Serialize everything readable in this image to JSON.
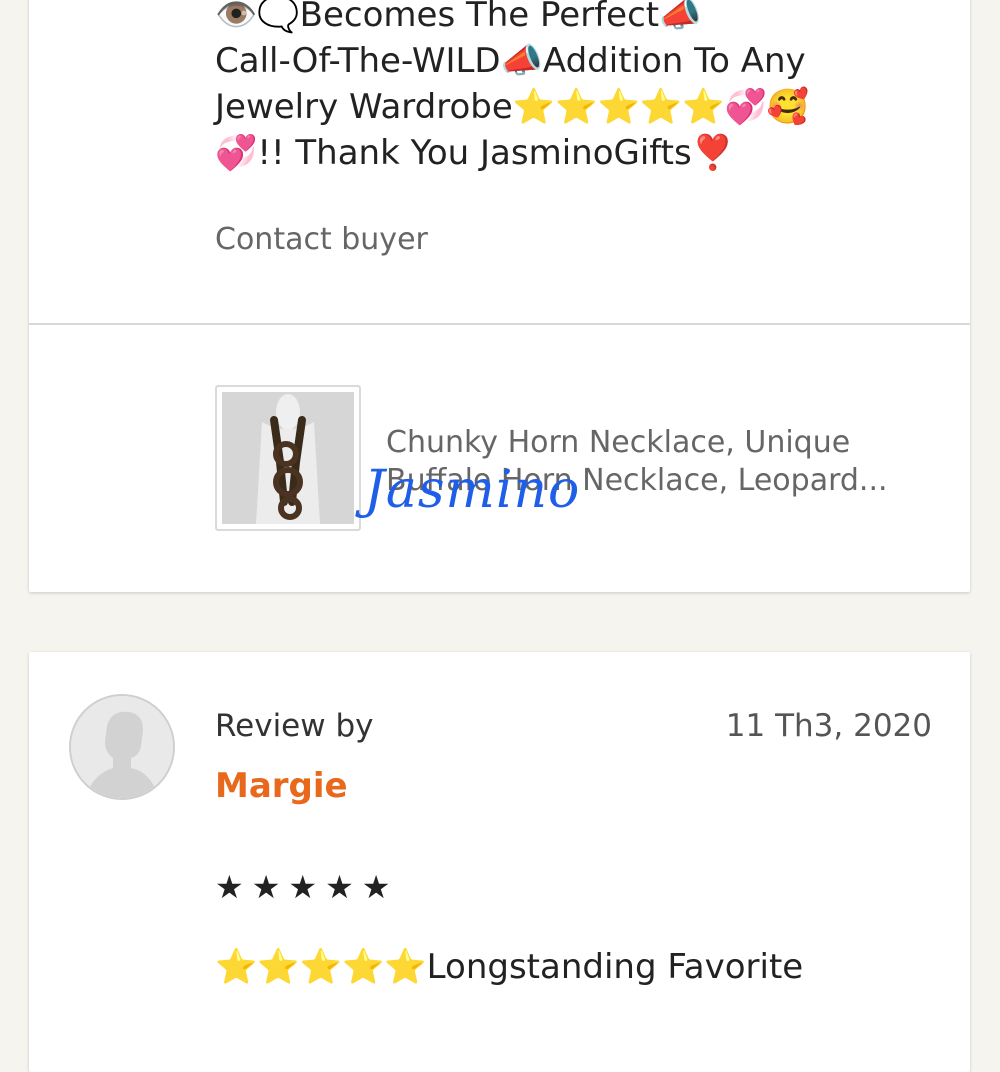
{
  "review1": {
    "text_lines": [
      "👁️🗨️Becomes The Perfect📣",
      "Call-Of-The-WILD📣Addition To Any",
      "Jewelry Wardrobe⭐⭐⭐⭐⭐💞🥰",
      "💞!! Thank You JasminoGifts❣️"
    ],
    "contact_label": "Contact buyer"
  },
  "product": {
    "title_lines": [
      "Chunky Horn Necklace, Unique",
      "Buffalo Horn Necklace, Leopard..."
    ],
    "image_icon": "necklace-photo"
  },
  "watermark": "Jasmino",
  "review2": {
    "avatar_icon": "default-user-avatar-icon",
    "review_by_label": "Review by",
    "reviewer_name": "Margie",
    "date": "11 Th3, 2020",
    "stars": "★★★★★",
    "rating": 5,
    "text_line": "⭐⭐⭐⭐⭐Longstanding Favorite"
  },
  "colors": {
    "background": "#f5f4ef",
    "name": "#e8691c",
    "watermark": "#1f5ee8"
  }
}
